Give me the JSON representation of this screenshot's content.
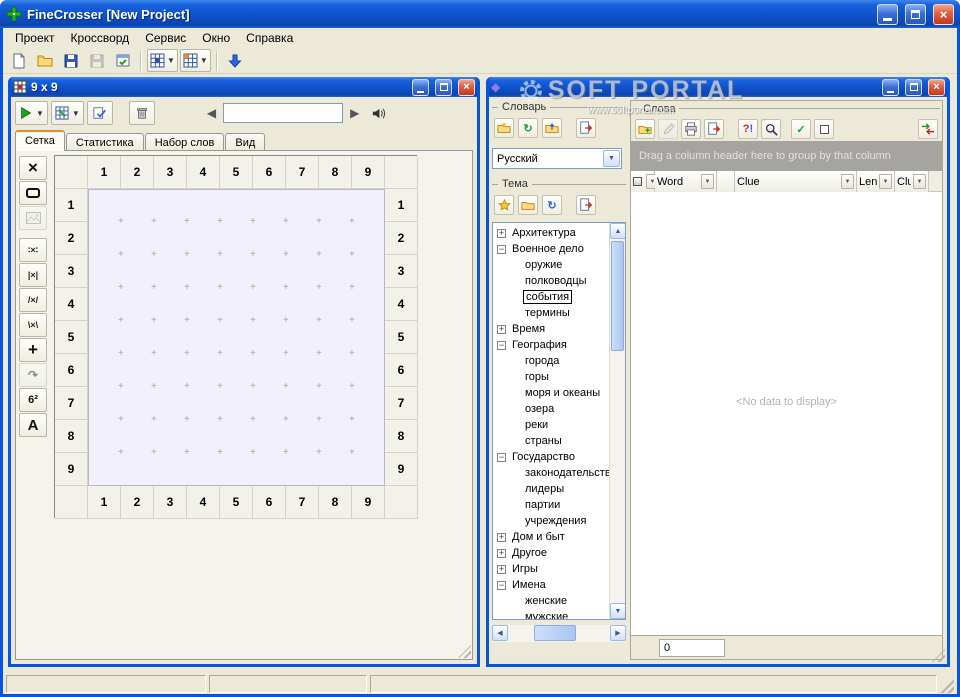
{
  "app": {
    "title": "FineCrosser [New Project]",
    "menu": [
      "Проект",
      "Кроссворд",
      "Сервис",
      "Окно",
      "Справка"
    ]
  },
  "grid_window": {
    "title": "9 x 9",
    "search_value": "",
    "tabs": [
      {
        "label": "Сетка",
        "active": true
      },
      {
        "label": "Статистика",
        "active": false
      },
      {
        "label": "Набор слов",
        "active": false
      },
      {
        "label": "Вид",
        "active": false
      }
    ],
    "numbers": [
      "1",
      "2",
      "3",
      "4",
      "5",
      "6",
      "7",
      "8",
      "9"
    ],
    "exponent_tool": "6²",
    "letter_tool": "A"
  },
  "words_window": {
    "dictionary_group": "Словарь",
    "language": "Русский",
    "theme_group": "Тема",
    "words_group": "Слова",
    "group_hint": "Drag a column header here to group by that column",
    "columns": [
      "",
      "Word",
      "",
      "Clue",
      "Len",
      "Clu"
    ],
    "no_data": "<No data to display>",
    "count": "0",
    "tree": [
      {
        "label": "Архитектура",
        "level": 0,
        "toggle": "plus"
      },
      {
        "label": "Военное дело",
        "level": 0,
        "toggle": "minus"
      },
      {
        "label": "оружие",
        "level": 1
      },
      {
        "label": "полководцы",
        "level": 1
      },
      {
        "label": "события",
        "level": 1,
        "selected": true
      },
      {
        "label": "термины",
        "level": 1
      },
      {
        "label": "Время",
        "level": 0,
        "toggle": "plus"
      },
      {
        "label": "География",
        "level": 0,
        "toggle": "minus"
      },
      {
        "label": "города",
        "level": 1
      },
      {
        "label": "горы",
        "level": 1
      },
      {
        "label": "моря и океаны",
        "level": 1
      },
      {
        "label": "озера",
        "level": 1
      },
      {
        "label": "реки",
        "level": 1
      },
      {
        "label": "страны",
        "level": 1
      },
      {
        "label": "Государство",
        "level": 0,
        "toggle": "minus"
      },
      {
        "label": "законодательство",
        "level": 1
      },
      {
        "label": "лидеры",
        "level": 1
      },
      {
        "label": "партии",
        "level": 1
      },
      {
        "label": "учреждения",
        "level": 1
      },
      {
        "label": "Дом и быт",
        "level": 0,
        "toggle": "plus"
      },
      {
        "label": "Другое",
        "level": 0,
        "toggle": "plus"
      },
      {
        "label": "Игры",
        "level": 0,
        "toggle": "plus"
      },
      {
        "label": "Имена",
        "level": 0,
        "toggle": "minus"
      },
      {
        "label": "женские",
        "level": 1
      },
      {
        "label": "мужские",
        "level": 1
      }
    ]
  },
  "watermark": {
    "title": "SOFT PORTAL",
    "url": "www.softportal.com"
  }
}
